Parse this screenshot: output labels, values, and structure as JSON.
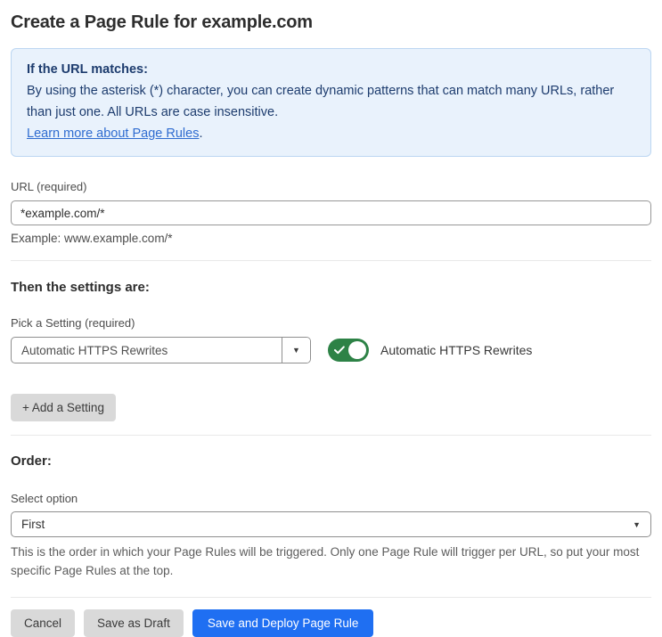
{
  "page": {
    "title": "Create a Page Rule for example.com"
  },
  "info_box": {
    "heading": "If the URL matches:",
    "body": "By using the asterisk (*) character, you can create dynamic patterns that can match many URLs, rather than just one. All URLs are case insensitive.",
    "link_text": "Learn more about Page Rules",
    "link_suffix": "."
  },
  "url_field": {
    "label": "URL (required)",
    "value": "*example.com/*",
    "helper": "Example: www.example.com/*"
  },
  "settings_section": {
    "heading": "Then the settings are:",
    "picker_label": "Pick a Setting (required)",
    "picker_value": "Automatic HTTPS Rewrites",
    "picker_arrow": "▼",
    "toggle_state": "on",
    "toggle_label": "Automatic HTTPS Rewrites",
    "add_setting_button": "+ Add a Setting"
  },
  "order_section": {
    "heading": "Order:",
    "select_label": "Select option",
    "select_value": "First",
    "select_arrow": "▼",
    "helper": "This is the order in which your Page Rules will be triggered. Only one Page Rule will trigger per URL, so put your most specific Page Rules at the top."
  },
  "footer": {
    "cancel_label": "Cancel",
    "save_draft_label": "Save as Draft",
    "deploy_label": "Save and Deploy Page Rule"
  },
  "colors": {
    "accent_blue": "#1f6ff2",
    "info_bg": "#e9f2fc",
    "info_border": "#bcd6f2",
    "info_text": "#1d3c6e",
    "link_blue": "#2f6cd0",
    "toggle_green": "#2d8246",
    "button_gray": "#d9d9d9"
  }
}
